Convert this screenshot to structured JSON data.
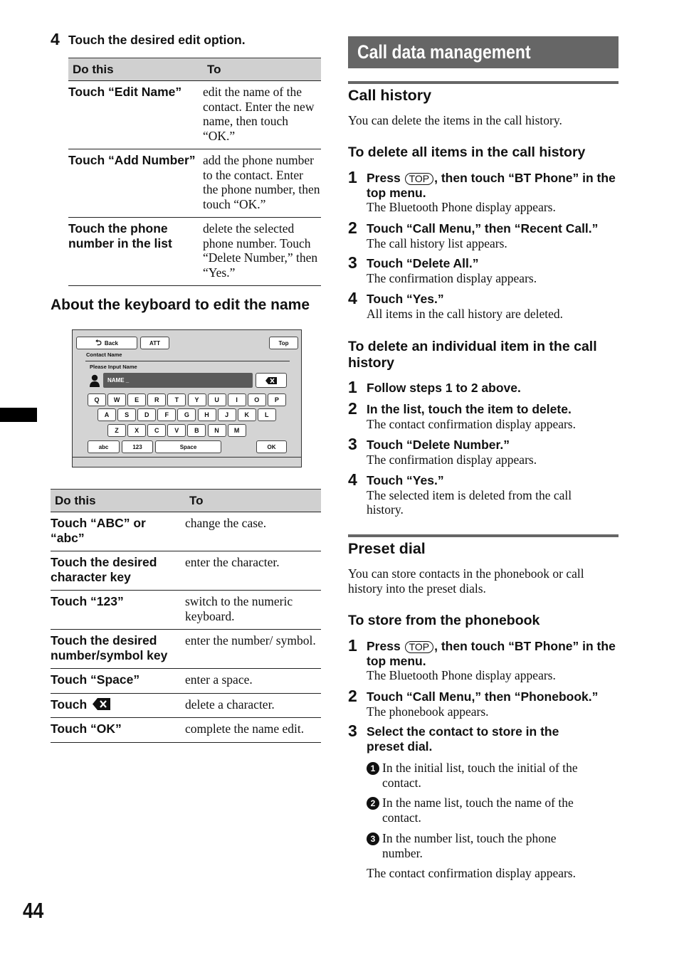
{
  "page_number": "44",
  "left": {
    "step4": {
      "num": "4",
      "text": "Touch the desired edit option."
    },
    "edit_table": {
      "headers": [
        "Do this",
        "To"
      ],
      "rows": [
        {
          "do": "Touch “Edit Name”",
          "to": "edit the name of the contact. Enter the new name, then touch “OK.”"
        },
        {
          "do": "Touch “Add Number”",
          "to": "add the phone number to the contact. Enter the phone number, then touch “OK.”"
        },
        {
          "do": "Touch the phone number in the list",
          "to": "delete the selected phone number. Touch “Delete Number,” then “Yes.”"
        }
      ]
    },
    "keyboard_heading": "About the keyboard to edit the name",
    "keyboard_screen": {
      "back": "Back",
      "att": "ATT",
      "top": "Top",
      "contact_name_label": "Contact Name",
      "input_label": "Please Input Name",
      "name_field": "NAME _",
      "row1": [
        "Q",
        "W",
        "E",
        "R",
        "T",
        "Y",
        "U",
        "I",
        "O",
        "P"
      ],
      "row2": [
        "A",
        "S",
        "D",
        "F",
        "G",
        "H",
        "J",
        "K",
        "L"
      ],
      "row3": [
        "Z",
        "X",
        "C",
        "V",
        "B",
        "N",
        "M"
      ],
      "abc": "abc",
      "num": "123",
      "space": "Space",
      "ok": "OK"
    },
    "keyboard_table": {
      "headers": [
        "Do this",
        "To"
      ],
      "rows": [
        {
          "do": "Touch “ABC” or “abc”",
          "to": "change the case."
        },
        {
          "do": "Touch the desired character key",
          "to": "enter the character."
        },
        {
          "do": "Touch “123”",
          "to": "switch to the numeric keyboard."
        },
        {
          "do": "Touch the desired number/symbol key",
          "to": "enter the number/ symbol."
        },
        {
          "do": "Touch “Space”",
          "to": "enter a space."
        },
        {
          "do": "Touch",
          "to": "delete a character.",
          "icon": "backspace-icon"
        },
        {
          "do": "Touch “OK”",
          "to": "complete the name edit."
        }
      ]
    }
  },
  "right": {
    "banner": "Call data management",
    "call_history": {
      "title": "Call history",
      "intro": "You can delete the items in the call history.",
      "delete_all": {
        "title": "To delete all items in the call history",
        "steps": [
          {
            "num": "1",
            "pre": "Press",
            "button": "TOP",
            "post": ", then touch “BT Phone” in the top menu.",
            "body": "The Bluetooth Phone display appears."
          },
          {
            "num": "2",
            "head": "Touch “Call Menu,” then “Recent Call.”",
            "body": "The call history list appears."
          },
          {
            "num": "3",
            "head": "Touch “Delete All.”",
            "body": "The confirmation display appears."
          },
          {
            "num": "4",
            "head": "Touch “Yes.”",
            "body": "All items in the call history are deleted."
          }
        ]
      },
      "delete_one": {
        "title": "To delete an individual item in the call history",
        "steps": [
          {
            "num": "1",
            "head": "Follow steps 1 to 2 above.",
            "body": ""
          },
          {
            "num": "2",
            "head": "In the list, touch the item to delete.",
            "body": "The contact confirmation display appears."
          },
          {
            "num": "3",
            "head": "Touch “Delete Number.”",
            "body": "The confirmation display appears."
          },
          {
            "num": "4",
            "head": "Touch “Yes.”",
            "body": "The selected item is deleted from the call history."
          }
        ]
      }
    },
    "preset_dial": {
      "title": "Preset dial",
      "intro": "You can store contacts in the phonebook or call history into the preset dials.",
      "from_phonebook": {
        "title": "To store from the phonebook",
        "steps": [
          {
            "num": "1",
            "pre": "Press",
            "button": "TOP",
            "post": ", then touch “BT Phone” in the top menu.",
            "body": "The Bluetooth Phone display appears."
          },
          {
            "num": "2",
            "head": "Touch “Call Menu,” then “Phonebook.”",
            "body": "The phonebook appears."
          },
          {
            "num": "3",
            "head": "Select the contact to store in the preset dial.",
            "body": ""
          }
        ],
        "substeps": [
          {
            "num": "1",
            "text": "In the initial list, touch the initial of the contact."
          },
          {
            "num": "2",
            "text": "In the name list, touch the name of the contact."
          },
          {
            "num": "3",
            "text": "In the number list, touch the phone number."
          }
        ],
        "result": "The contact confirmation display appears."
      }
    }
  }
}
